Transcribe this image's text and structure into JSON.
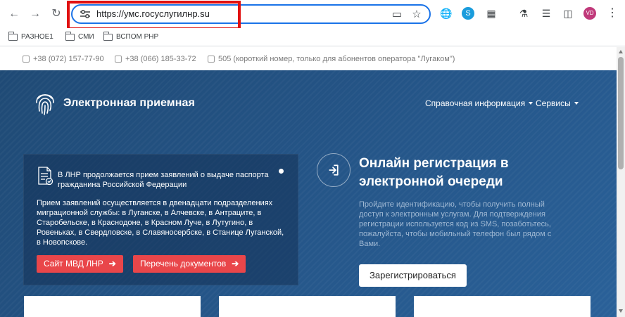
{
  "browser": {
    "url": "https://умс.госуслугилнр.su",
    "nav_icons": [
      "back-arrow-icon",
      "forward-arrow-icon",
      "reload-icon"
    ],
    "avatar_initials": "VD"
  },
  "bookmarks": [
    {
      "label": "РАЗНОЕ1"
    },
    {
      "label": "СМИ"
    },
    {
      "label": "ВСПОМ РНР"
    }
  ],
  "contacts": {
    "phone1": "+38 (072) 157-77-90",
    "phone2": "+38 (066) 185-33-72",
    "short": "505 (короткий номер, только для абонентов оператора \"Лугаком\")"
  },
  "header": {
    "brand": "Электронная приемная",
    "nav": [
      "Справочная информация",
      "Сервисы"
    ]
  },
  "news": {
    "title": "В ЛНР продолжается прием заявлений о выдаче паспорта гражданина Российской Федерации",
    "body": "Прием заявлений осуществляется в двенадцати подразделениях миграционной службы: в Луганске, в Алчевске, в Антраците, в Старобельске, в Краснодоне, в Красном Луче, в Лутугино, в Ровеньках, в Свердловске, в Славяносербске, в Станице Луганской, в Новопскове.",
    "btn_site": "Сайт МВД ЛНР",
    "btn_docs": "Перечень документов"
  },
  "registration": {
    "title": "Онлайн регистрация в электронной очереди",
    "text": "Пройдите идентификацию, чтобы получить полный доступ к электронным услугам. Для подтверждения регистрации используется код из SMS, позаботьтесь, пожалуйста, чтобы мобильный телефон был рядом с Вами.",
    "button": "Зарегистрироваться"
  },
  "colors": {
    "accent_red": "#e9464a",
    "hero_blue": "#245486",
    "highlight_box": "#e01010",
    "omnibox_border": "#1a73e8"
  }
}
